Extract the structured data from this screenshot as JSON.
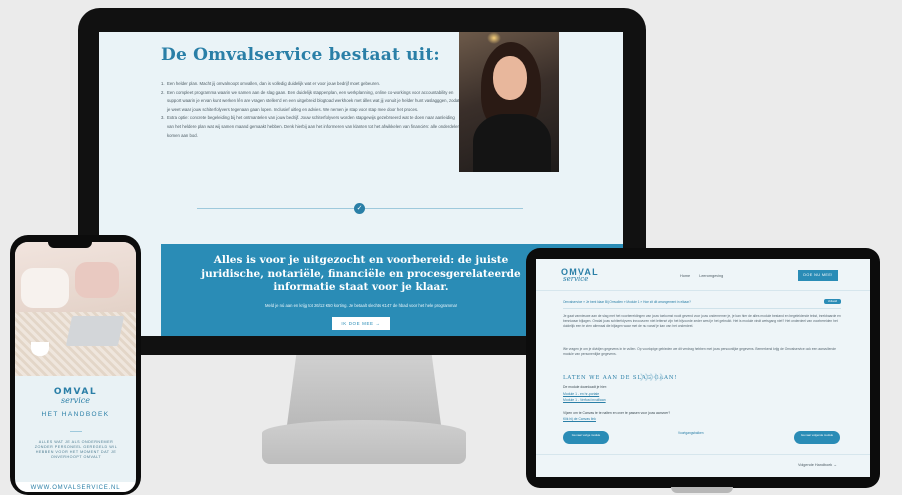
{
  "desktop": {
    "heading": "De Omvalservice bestaat uit:",
    "list": [
      {
        "n": "1.",
        "text": "Een helder plan. Macht jij omvalnoopt omvallen, dan is volledig duidelijk wat er voor jouw bedrijf moet gebeuren."
      },
      {
        "n": "2.",
        "text": "Een compleet programma waarin we samen aan de slag gaan. Een duidelijk stappenplan, een werkplanning, online co-workings voor accountability en support waarin je ervan kunt werken lên are vragen stellen'd en een uitgebreid blogtoad werkhoek met álles wat jij vonuit je helder hunt vaslagggen, zodat je weet waar jouw schiterfolyvers tegenaan gaan lopen. Inclusief uitleg en advies. We nemen je stap voor stap mee door het proces."
      },
      {
        "n": "3.",
        "text": "Extra optie: concrete begeleiding bij het ontmantelen van jouw bedrijf. Jouw schiterfolyvers worden stapgewijs gezebrseerd wat te doen naar aanleiding van het heldere plan wat wij samen maand gemaakt hebben. Denk hierbij aan het informeren van klanten tot het afwikkelen van financiën: alle onderdelen komen aan bod."
      }
    ],
    "divider_icon": "✓",
    "band_title": "Alles is voor je uitgezocht en voorbereid: de juiste juridische, notariële, financiële en procesgerelateerde informatie staat voor je klaar.",
    "band_text": "Meld je nú aan en krijg tot 26/12 €50 korting. Je betaalt slechts €147 de hbad voor het hele programma!",
    "band_button": "IK DOE MEE  →"
  },
  "phone": {
    "logo_top": "OMVAL",
    "logo_sub": "service",
    "handboek": "HET HANDBOEK",
    "desc": "ALLES WAT JE ALS ONDERNEMER ZONDER PERSONEEL GEREGELD WIL HEBBEN VOOR HET MOMENT DAT JE ONVERHOOPT OMVALT",
    "url": "WWW.OMVALSERVICE.NL"
  },
  "tablet": {
    "logo_top": "OMVAL",
    "logo_sub": "service",
    "nav": [
      "Home",
      "Leeromgeving"
    ],
    "cta": "DOE NU MEE!",
    "breadcrumb": "Omvalservice » Je bent klaar Bij Omvallen » Module 1 » Hoe zit dit arrangement in elkaar?",
    "badge": "Voltooid",
    "para1": "Je gaat vannieuwe aan de slag met het voorbereidingen van jouw toekomst nooit gevend voor jouw ondernemer je, je kan hier de alles module bestand en begeleidende tekst, inrekbaarde en benniwaar bijlagen. Omdat jouw schiterfolyvers innoovuren niet lettersé zijn het bijvoorde zeder west je het gebruikt. Het is module vindt wetsgang niet? Het onderdeel van voorbereiden het duidelijk een te zien allemaal die bijlagen waar met de nu vanaf je kan van het onderdeel.",
    "para2": "We vragen je om je dividjen gegevens in te vullen. Op voorlopige gebieden we dit verdrag hebben met jouw persoonlijke gegevens. Bemerkend krijg de Omvalservice ook een aanvullende module van personenlijke gegevens.",
    "subheading": "LATEN WE AAN DE SLAG GAAN!",
    "arrows": "❯❯❯❯❯",
    "download_label": "De module downloadt je hier:",
    "links": [
      "Module 1 - en hr-portale",
      "Module 1 - Verfust invulllaan"
    ],
    "question": "Vijzen om te Canvas te te nalten en over te passen voor jouw aanvoer?",
    "question_link": "Klik hij de Canvas link",
    "prev": "Ga naar vorige module",
    "center": "Voortgangsbalken",
    "next": "Ga naar volgende module",
    "footer": "Volgende Handboek →"
  }
}
